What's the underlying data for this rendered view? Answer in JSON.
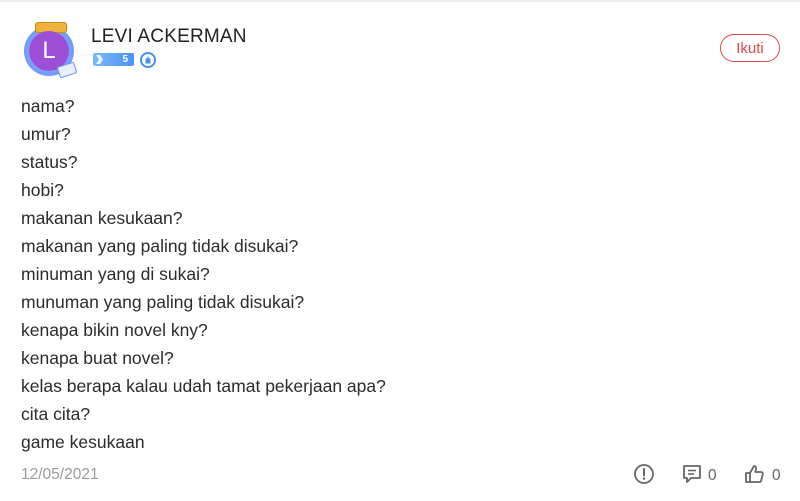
{
  "post": {
    "author": {
      "name": "LEVI ACKERMAN",
      "avatar_letter": "L",
      "level": "5",
      "avatar_color": "#9c4fd6"
    },
    "follow_label": "Ikuti",
    "lines": [
      "nama?",
      "umur?",
      "status?",
      "hobi?",
      "makanan kesukaan?",
      "makanan yang paling tidak disukai?",
      "minuman yang di sukai?",
      "munuman yang paling tidak disukai?",
      "kenapa bikin novel kny?",
      "kenapa buat novel?",
      "kelas berapa kalau udah tamat pekerjaan apa?",
      "cita cita?",
      "game kesukaan"
    ],
    "date": "12/05/2021",
    "comment_count": "0",
    "like_count": "0"
  },
  "icons": {
    "report": "exclamation-circle-icon",
    "comment": "comment-bubble-icon",
    "like": "thumbs-up-icon",
    "verified": "verified-badge-icon"
  },
  "colors": {
    "accent": "#e0474b",
    "level_badge": "#4a94f2",
    "muted_text": "#9a9a9a"
  }
}
